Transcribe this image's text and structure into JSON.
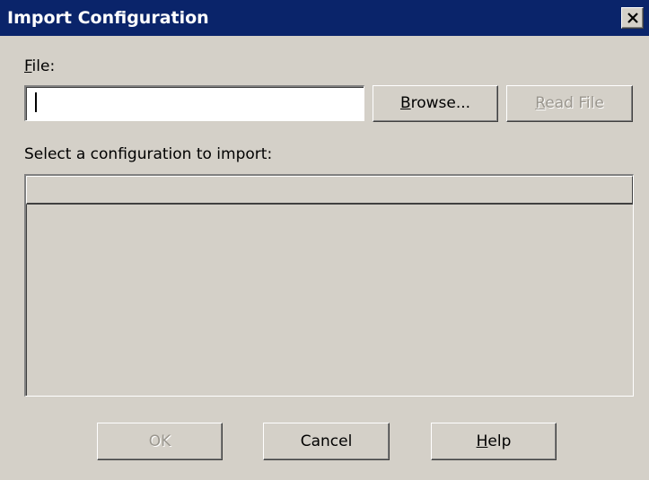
{
  "window": {
    "title": "Import Configuration"
  },
  "file": {
    "label_access": "F",
    "label_rest": "ile:",
    "value": "",
    "placeholder": ""
  },
  "buttons": {
    "browse_access": "B",
    "browse_rest": "rowse...",
    "read_access": "R",
    "read_rest": "ead File",
    "ok_label": "OK",
    "cancel_label": "Cancel",
    "help_access": "H",
    "help_rest": "elp"
  },
  "list": {
    "label": "Select a configuration to import:",
    "items": []
  },
  "icons": {
    "close": "close-icon"
  },
  "colors": {
    "titlebar": "#0a246a",
    "face": "#d4d0c8",
    "disabled_text": "#9a968e"
  }
}
